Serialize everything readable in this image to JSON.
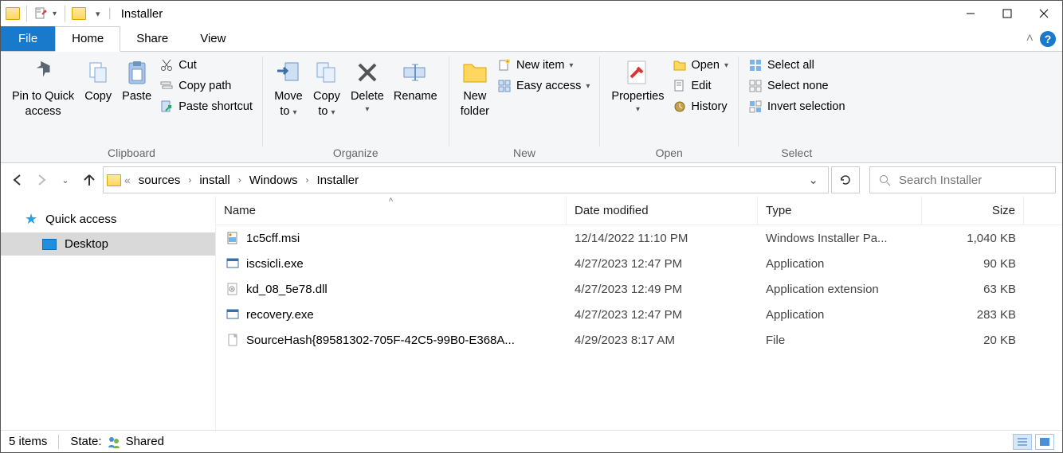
{
  "title": "Installer",
  "tabs": {
    "file": "File",
    "home": "Home",
    "share": "Share",
    "view": "View"
  },
  "ribbon": {
    "clipboard": {
      "label": "Clipboard",
      "pin": "Pin to Quick access",
      "copy": "Copy",
      "paste": "Paste",
      "cut": "Cut",
      "copypath": "Copy path",
      "pasteshort": "Paste shortcut"
    },
    "organize": {
      "label": "Organize",
      "moveto": "Move to",
      "copyto": "Copy to",
      "delete": "Delete",
      "rename": "Rename"
    },
    "new": {
      "label": "New",
      "newfolder": "New folder",
      "newitem": "New item",
      "easyaccess": "Easy access"
    },
    "open": {
      "label": "Open",
      "properties": "Properties",
      "open": "Open",
      "edit": "Edit",
      "history": "History"
    },
    "select": {
      "label": "Select",
      "all": "Select all",
      "none": "Select none",
      "invert": "Invert selection"
    }
  },
  "breadcrumb": [
    "sources",
    "install",
    "Windows",
    "Installer"
  ],
  "search_placeholder": "Search Installer",
  "sidebar": {
    "quick": "Quick access",
    "desktop": "Desktop"
  },
  "columns": {
    "name": "Name",
    "date": "Date modified",
    "type": "Type",
    "size": "Size"
  },
  "files": [
    {
      "name": "1c5cff.msi",
      "date": "12/14/2022 11:10 PM",
      "type": "Windows Installer Pa...",
      "size": "1,040 KB",
      "icon": "msi"
    },
    {
      "name": "iscsicli.exe",
      "date": "4/27/2023 12:47 PM",
      "type": "Application",
      "size": "90 KB",
      "icon": "exe"
    },
    {
      "name": "kd_08_5e78.dll",
      "date": "4/27/2023 12:49 PM",
      "type": "Application extension",
      "size": "63 KB",
      "icon": "dll"
    },
    {
      "name": "recovery.exe",
      "date": "4/27/2023 12:47 PM",
      "type": "Application",
      "size": "283 KB",
      "icon": "exe"
    },
    {
      "name": "SourceHash{89581302-705F-42C5-99B0-E368A...",
      "date": "4/29/2023 8:17 AM",
      "type": "File",
      "size": "20 KB",
      "icon": "file"
    }
  ],
  "status": {
    "count": "5 items",
    "state_label": "State:",
    "state_value": "Shared"
  }
}
